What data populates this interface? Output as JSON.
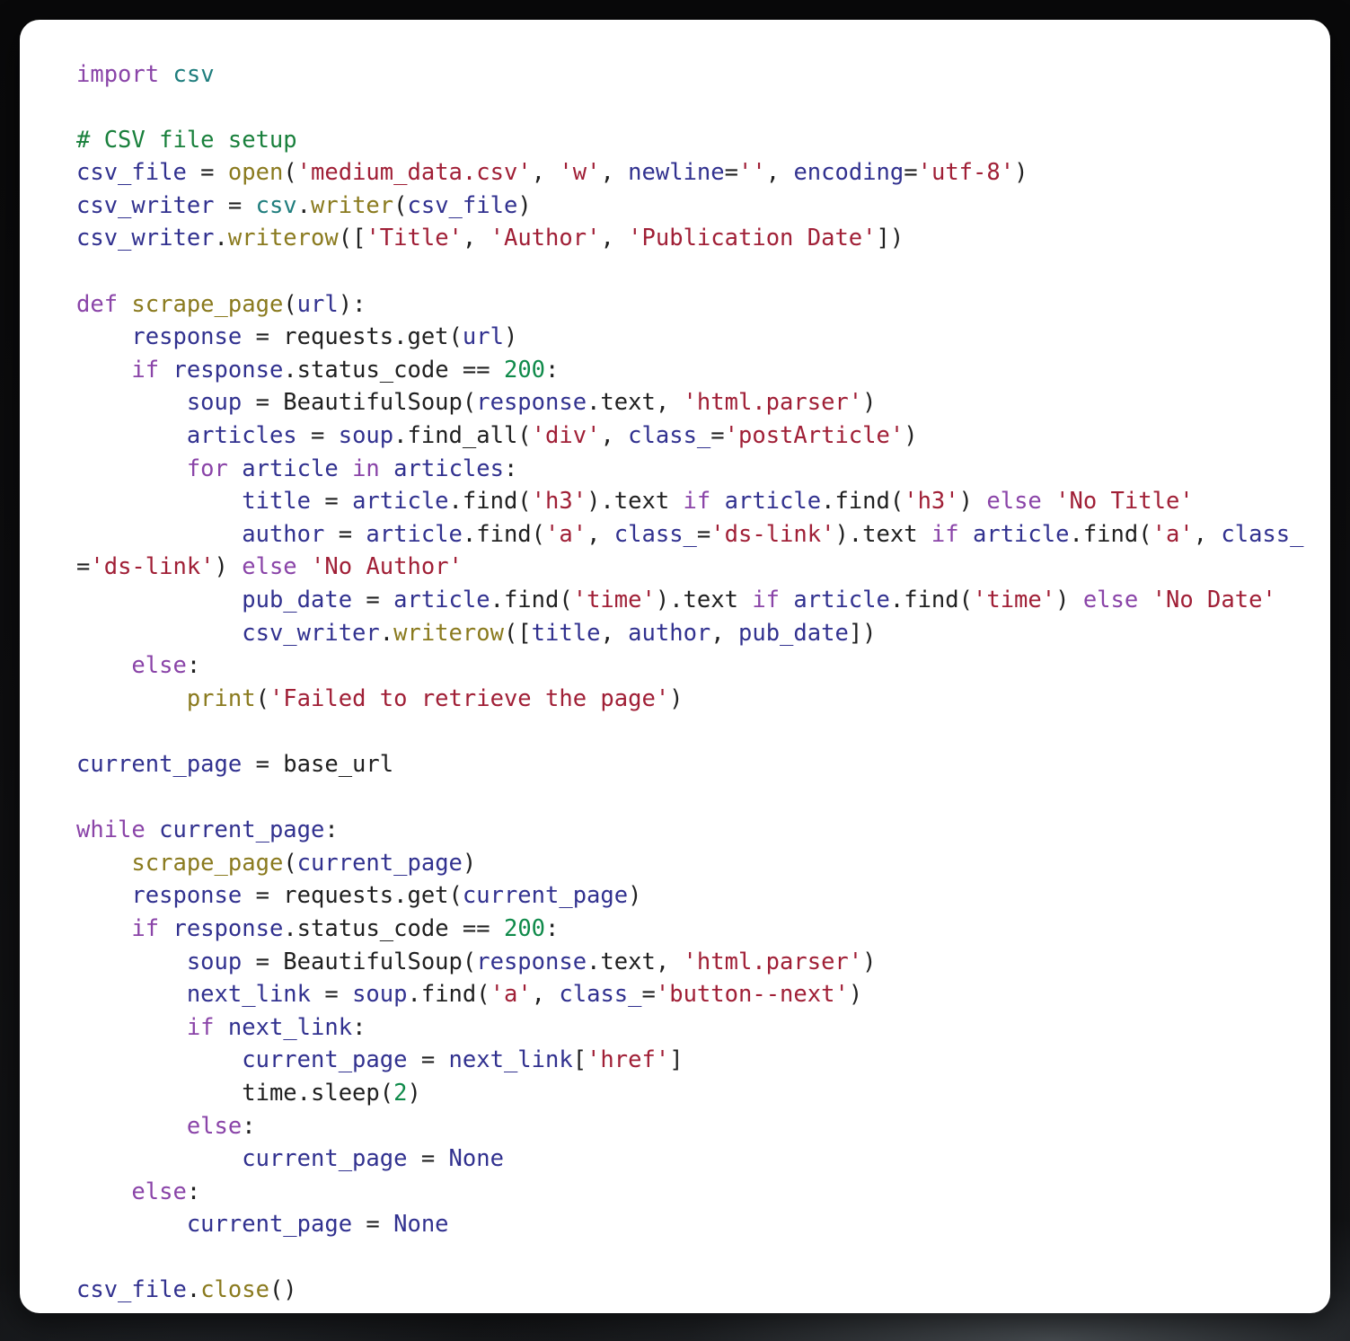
{
  "card": {
    "language": "python",
    "background_color": "#ffffff",
    "page_background_color": "#0d0d0e",
    "corner_radius_px": 22
  },
  "theme": {
    "keyword_color": "#8a44a8",
    "module_color": "#1f7d7d",
    "function_color": "#8a7a1e",
    "name_color": "#31318f",
    "string_color": "#a01f36",
    "number_color": "#0f8a4a",
    "comment_color": "#19803c",
    "plain_color": "#202020"
  },
  "code": {
    "lines": [
      {
        "id": "line-1",
        "indent": 0,
        "tokens": [
          {
            "t": "import",
            "c": "kw"
          },
          {
            "t": " ",
            "c": "pl"
          },
          {
            "t": "csv",
            "c": "mod"
          }
        ]
      },
      {
        "id": "line-2",
        "indent": 0,
        "tokens": []
      },
      {
        "id": "line-3",
        "indent": 0,
        "tokens": [
          {
            "t": "# CSV file setup",
            "c": "com"
          }
        ]
      },
      {
        "id": "line-4",
        "indent": 0,
        "tokens": [
          {
            "t": "csv_file",
            "c": "var"
          },
          {
            "t": " = ",
            "c": "pl"
          },
          {
            "t": "open",
            "c": "fn"
          },
          {
            "t": "(",
            "c": "pl"
          },
          {
            "t": "'medium_data.csv'",
            "c": "str"
          },
          {
            "t": ", ",
            "c": "pl"
          },
          {
            "t": "'w'",
            "c": "str"
          },
          {
            "t": ", ",
            "c": "pl"
          },
          {
            "t": "newline",
            "c": "var"
          },
          {
            "t": "=",
            "c": "pl"
          },
          {
            "t": "''",
            "c": "str"
          },
          {
            "t": ", ",
            "c": "pl"
          },
          {
            "t": "encoding",
            "c": "var"
          },
          {
            "t": "=",
            "c": "pl"
          },
          {
            "t": "'utf-8'",
            "c": "str"
          },
          {
            "t": ")",
            "c": "pl"
          }
        ]
      },
      {
        "id": "line-5",
        "indent": 0,
        "tokens": [
          {
            "t": "csv_writer",
            "c": "var"
          },
          {
            "t": " = ",
            "c": "pl"
          },
          {
            "t": "csv",
            "c": "mod"
          },
          {
            "t": ".",
            "c": "pl"
          },
          {
            "t": "writer",
            "c": "fn"
          },
          {
            "t": "(",
            "c": "pl"
          },
          {
            "t": "csv_file",
            "c": "var"
          },
          {
            "t": ")",
            "c": "pl"
          }
        ]
      },
      {
        "id": "line-6",
        "indent": 0,
        "tokens": [
          {
            "t": "csv_writer",
            "c": "var"
          },
          {
            "t": ".",
            "c": "pl"
          },
          {
            "t": "writerow",
            "c": "fn"
          },
          {
            "t": "([",
            "c": "pl"
          },
          {
            "t": "'Title'",
            "c": "str"
          },
          {
            "t": ", ",
            "c": "pl"
          },
          {
            "t": "'Author'",
            "c": "str"
          },
          {
            "t": ", ",
            "c": "pl"
          },
          {
            "t": "'Publication Date'",
            "c": "str"
          },
          {
            "t": "])",
            "c": "pl"
          }
        ]
      },
      {
        "id": "line-7",
        "indent": 0,
        "tokens": []
      },
      {
        "id": "line-8",
        "indent": 0,
        "tokens": [
          {
            "t": "def",
            "c": "kw"
          },
          {
            "t": " ",
            "c": "pl"
          },
          {
            "t": "scrape_page",
            "c": "fn"
          },
          {
            "t": "(",
            "c": "pl"
          },
          {
            "t": "url",
            "c": "var"
          },
          {
            "t": "):",
            "c": "pl"
          }
        ]
      },
      {
        "id": "line-9",
        "indent": 1,
        "tokens": [
          {
            "t": "response",
            "c": "var"
          },
          {
            "t": " = requests.get(",
            "c": "pl"
          },
          {
            "t": "url",
            "c": "var"
          },
          {
            "t": ")",
            "c": "pl"
          }
        ]
      },
      {
        "id": "line-10",
        "indent": 1,
        "tokens": [
          {
            "t": "if",
            "c": "kw"
          },
          {
            "t": " ",
            "c": "pl"
          },
          {
            "t": "response",
            "c": "var"
          },
          {
            "t": ".status_code == ",
            "c": "pl"
          },
          {
            "t": "200",
            "c": "num"
          },
          {
            "t": ":",
            "c": "pl"
          }
        ]
      },
      {
        "id": "line-11",
        "indent": 2,
        "tokens": [
          {
            "t": "soup",
            "c": "var"
          },
          {
            "t": " = BeautifulSoup(",
            "c": "pl"
          },
          {
            "t": "response",
            "c": "var"
          },
          {
            "t": ".text, ",
            "c": "pl"
          },
          {
            "t": "'html.parser'",
            "c": "str"
          },
          {
            "t": ")",
            "c": "pl"
          }
        ]
      },
      {
        "id": "line-12",
        "indent": 2,
        "tokens": [
          {
            "t": "articles",
            "c": "var"
          },
          {
            "t": " = ",
            "c": "pl"
          },
          {
            "t": "soup",
            "c": "var"
          },
          {
            "t": ".find_all(",
            "c": "pl"
          },
          {
            "t": "'div'",
            "c": "str"
          },
          {
            "t": ", ",
            "c": "pl"
          },
          {
            "t": "class_",
            "c": "var"
          },
          {
            "t": "=",
            "c": "pl"
          },
          {
            "t": "'postArticle'",
            "c": "str"
          },
          {
            "t": ")",
            "c": "pl"
          }
        ]
      },
      {
        "id": "line-13",
        "indent": 2,
        "tokens": [
          {
            "t": "for",
            "c": "kw"
          },
          {
            "t": " ",
            "c": "pl"
          },
          {
            "t": "article",
            "c": "var"
          },
          {
            "t": " ",
            "c": "pl"
          },
          {
            "t": "in",
            "c": "kw"
          },
          {
            "t": " ",
            "c": "pl"
          },
          {
            "t": "articles",
            "c": "var"
          },
          {
            "t": ":",
            "c": "pl"
          }
        ]
      },
      {
        "id": "line-14",
        "indent": 3,
        "tokens": [
          {
            "t": "title",
            "c": "var"
          },
          {
            "t": " = ",
            "c": "pl"
          },
          {
            "t": "article",
            "c": "var"
          },
          {
            "t": ".find(",
            "c": "pl"
          },
          {
            "t": "'h3'",
            "c": "str"
          },
          {
            "t": ").text ",
            "c": "pl"
          },
          {
            "t": "if",
            "c": "kw"
          },
          {
            "t": " ",
            "c": "pl"
          },
          {
            "t": "article",
            "c": "var"
          },
          {
            "t": ".find(",
            "c": "pl"
          },
          {
            "t": "'h3'",
            "c": "str"
          },
          {
            "t": ") ",
            "c": "pl"
          },
          {
            "t": "else",
            "c": "kw"
          },
          {
            "t": " ",
            "c": "pl"
          },
          {
            "t": "'No Title'",
            "c": "str"
          }
        ]
      },
      {
        "id": "line-15",
        "indent": 3,
        "tokens": [
          {
            "t": "author",
            "c": "var"
          },
          {
            "t": " = ",
            "c": "pl"
          },
          {
            "t": "article",
            "c": "var"
          },
          {
            "t": ".find(",
            "c": "pl"
          },
          {
            "t": "'a'",
            "c": "str"
          },
          {
            "t": ", ",
            "c": "pl"
          },
          {
            "t": "class_",
            "c": "var"
          },
          {
            "t": "=",
            "c": "pl"
          },
          {
            "t": "'ds-link'",
            "c": "str"
          },
          {
            "t": ").text ",
            "c": "pl"
          },
          {
            "t": "if",
            "c": "kw"
          },
          {
            "t": " ",
            "c": "pl"
          },
          {
            "t": "article",
            "c": "var"
          },
          {
            "t": ".find(",
            "c": "pl"
          },
          {
            "t": "'a'",
            "c": "str"
          },
          {
            "t": ", ",
            "c": "pl"
          },
          {
            "t": "class_",
            "c": "var"
          }
        ]
      },
      {
        "id": "line-16",
        "indent": 0,
        "wrapped": true,
        "tokens": [
          {
            "t": "=",
            "c": "pl"
          },
          {
            "t": "'ds-link'",
            "c": "str"
          },
          {
            "t": ") ",
            "c": "pl"
          },
          {
            "t": "else",
            "c": "kw"
          },
          {
            "t": " ",
            "c": "pl"
          },
          {
            "t": "'No Author'",
            "c": "str"
          }
        ]
      },
      {
        "id": "line-17",
        "indent": 3,
        "tokens": [
          {
            "t": "pub_date",
            "c": "var"
          },
          {
            "t": " = ",
            "c": "pl"
          },
          {
            "t": "article",
            "c": "var"
          },
          {
            "t": ".find(",
            "c": "pl"
          },
          {
            "t": "'time'",
            "c": "str"
          },
          {
            "t": ").text ",
            "c": "pl"
          },
          {
            "t": "if",
            "c": "kw"
          },
          {
            "t": " ",
            "c": "pl"
          },
          {
            "t": "article",
            "c": "var"
          },
          {
            "t": ".find(",
            "c": "pl"
          },
          {
            "t": "'time'",
            "c": "str"
          },
          {
            "t": ") ",
            "c": "pl"
          },
          {
            "t": "else",
            "c": "kw"
          },
          {
            "t": " ",
            "c": "pl"
          },
          {
            "t": "'No Date'",
            "c": "str"
          }
        ]
      },
      {
        "id": "line-18",
        "indent": 3,
        "tokens": [
          {
            "t": "csv_writer",
            "c": "var"
          },
          {
            "t": ".",
            "c": "pl"
          },
          {
            "t": "writerow",
            "c": "fn"
          },
          {
            "t": "([",
            "c": "pl"
          },
          {
            "t": "title",
            "c": "var"
          },
          {
            "t": ", ",
            "c": "pl"
          },
          {
            "t": "author",
            "c": "var"
          },
          {
            "t": ", ",
            "c": "pl"
          },
          {
            "t": "pub_date",
            "c": "var"
          },
          {
            "t": "])",
            "c": "pl"
          }
        ]
      },
      {
        "id": "line-19",
        "indent": 1,
        "tokens": [
          {
            "t": "else",
            "c": "kw"
          },
          {
            "t": ":",
            "c": "pl"
          }
        ]
      },
      {
        "id": "line-20",
        "indent": 2,
        "tokens": [
          {
            "t": "print",
            "c": "fn"
          },
          {
            "t": "(",
            "c": "pl"
          },
          {
            "t": "'Failed to retrieve the page'",
            "c": "str"
          },
          {
            "t": ")",
            "c": "pl"
          }
        ]
      },
      {
        "id": "line-21",
        "indent": 0,
        "tokens": []
      },
      {
        "id": "line-22",
        "indent": 0,
        "tokens": [
          {
            "t": "current_page",
            "c": "var"
          },
          {
            "t": " = base_url",
            "c": "pl"
          }
        ]
      },
      {
        "id": "line-23",
        "indent": 0,
        "tokens": []
      },
      {
        "id": "line-24",
        "indent": 0,
        "tokens": [
          {
            "t": "while",
            "c": "kw"
          },
          {
            "t": " ",
            "c": "pl"
          },
          {
            "t": "current_page",
            "c": "var"
          },
          {
            "t": ":",
            "c": "pl"
          }
        ]
      },
      {
        "id": "line-25",
        "indent": 1,
        "tokens": [
          {
            "t": "scrape_page",
            "c": "fn"
          },
          {
            "t": "(",
            "c": "pl"
          },
          {
            "t": "current_page",
            "c": "var"
          },
          {
            "t": ")",
            "c": "pl"
          }
        ]
      },
      {
        "id": "line-26",
        "indent": 1,
        "tokens": [
          {
            "t": "response",
            "c": "var"
          },
          {
            "t": " = requests.get(",
            "c": "pl"
          },
          {
            "t": "current_page",
            "c": "var"
          },
          {
            "t": ")",
            "c": "pl"
          }
        ]
      },
      {
        "id": "line-27",
        "indent": 1,
        "tokens": [
          {
            "t": "if",
            "c": "kw"
          },
          {
            "t": " ",
            "c": "pl"
          },
          {
            "t": "response",
            "c": "var"
          },
          {
            "t": ".status_code == ",
            "c": "pl"
          },
          {
            "t": "200",
            "c": "num"
          },
          {
            "t": ":",
            "c": "pl"
          }
        ]
      },
      {
        "id": "line-28",
        "indent": 2,
        "tokens": [
          {
            "t": "soup",
            "c": "var"
          },
          {
            "t": " = BeautifulSoup(",
            "c": "pl"
          },
          {
            "t": "response",
            "c": "var"
          },
          {
            "t": ".text, ",
            "c": "pl"
          },
          {
            "t": "'html.parser'",
            "c": "str"
          },
          {
            "t": ")",
            "c": "pl"
          }
        ]
      },
      {
        "id": "line-29",
        "indent": 2,
        "tokens": [
          {
            "t": "next_link",
            "c": "var"
          },
          {
            "t": " = ",
            "c": "pl"
          },
          {
            "t": "soup",
            "c": "var"
          },
          {
            "t": ".find(",
            "c": "pl"
          },
          {
            "t": "'a'",
            "c": "str"
          },
          {
            "t": ", ",
            "c": "pl"
          },
          {
            "t": "class_",
            "c": "var"
          },
          {
            "t": "=",
            "c": "pl"
          },
          {
            "t": "'button--next'",
            "c": "str"
          },
          {
            "t": ")",
            "c": "pl"
          }
        ]
      },
      {
        "id": "line-30",
        "indent": 2,
        "tokens": [
          {
            "t": "if",
            "c": "kw"
          },
          {
            "t": " ",
            "c": "pl"
          },
          {
            "t": "next_link",
            "c": "var"
          },
          {
            "t": ":",
            "c": "pl"
          }
        ]
      },
      {
        "id": "line-31",
        "indent": 3,
        "tokens": [
          {
            "t": "current_page",
            "c": "var"
          },
          {
            "t": " = ",
            "c": "pl"
          },
          {
            "t": "next_link",
            "c": "var"
          },
          {
            "t": "[",
            "c": "pl"
          },
          {
            "t": "'href'",
            "c": "str"
          },
          {
            "t": "]",
            "c": "pl"
          }
        ]
      },
      {
        "id": "line-32",
        "indent": 3,
        "tokens": [
          {
            "t": "time.sleep(",
            "c": "pl"
          },
          {
            "t": "2",
            "c": "num"
          },
          {
            "t": ")",
            "c": "pl"
          }
        ]
      },
      {
        "id": "line-33",
        "indent": 2,
        "tokens": [
          {
            "t": "else",
            "c": "kw"
          },
          {
            "t": ":",
            "c": "pl"
          }
        ]
      },
      {
        "id": "line-34",
        "indent": 3,
        "tokens": [
          {
            "t": "current_page",
            "c": "var"
          },
          {
            "t": " = ",
            "c": "pl"
          },
          {
            "t": "None",
            "c": "var"
          }
        ]
      },
      {
        "id": "line-35",
        "indent": 1,
        "tokens": [
          {
            "t": "else",
            "c": "kw"
          },
          {
            "t": ":",
            "c": "pl"
          }
        ]
      },
      {
        "id": "line-36",
        "indent": 2,
        "tokens": [
          {
            "t": "current_page",
            "c": "var"
          },
          {
            "t": " = ",
            "c": "pl"
          },
          {
            "t": "None",
            "c": "var"
          }
        ]
      },
      {
        "id": "line-37",
        "indent": 0,
        "tokens": []
      },
      {
        "id": "line-38",
        "indent": 0,
        "tokens": [
          {
            "t": "csv_file",
            "c": "var"
          },
          {
            "t": ".",
            "c": "pl"
          },
          {
            "t": "close",
            "c": "fn"
          },
          {
            "t": "()",
            "c": "pl"
          }
        ]
      }
    ]
  }
}
